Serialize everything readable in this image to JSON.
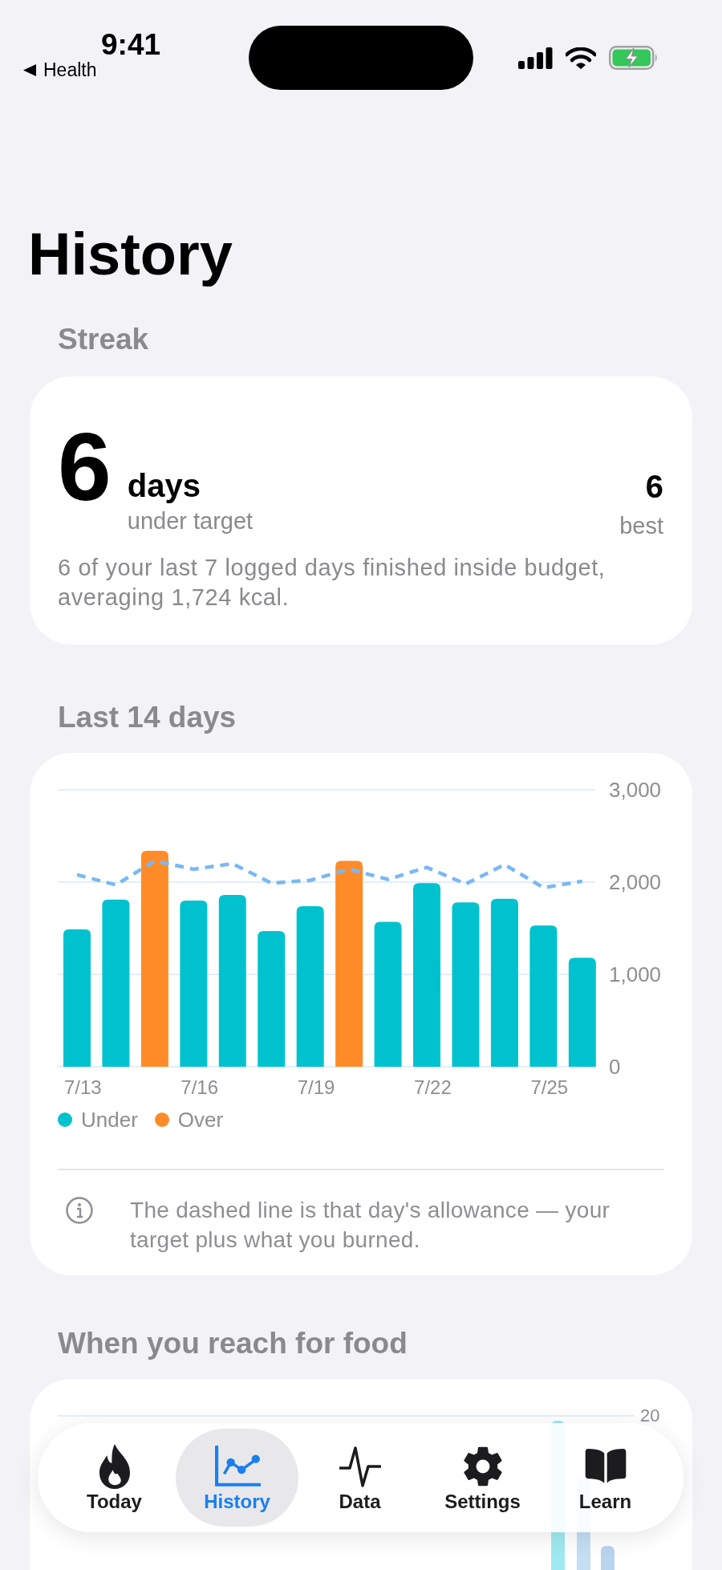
{
  "status_bar": {
    "time": "9:41",
    "back_label": "Health"
  },
  "title": "History",
  "streak": {
    "heading": "Streak",
    "count": "6",
    "unit": "days",
    "caption": "under target",
    "best_value": "6",
    "best_label": "best",
    "summary": "6 of your last 7 logged days finished inside budget, averaging 1,724 kcal."
  },
  "last_14_days": {
    "heading": "Last 14 days",
    "chart_data": {
      "type": "bar",
      "stacked": true,
      "categories": [
        "7/13",
        null,
        null,
        "7/16",
        null,
        null,
        "7/19",
        null,
        null,
        "7/22",
        null,
        null,
        "7/25",
        null
      ],
      "ylim": [
        0,
        3000
      ],
      "yticks": [
        {
          "value": 0,
          "label": "0"
        },
        {
          "value": 1000,
          "label": "1,000"
        },
        {
          "value": 2000,
          "label": "2,000"
        },
        {
          "value": 3000,
          "label": "3,000"
        }
      ],
      "series": [
        {
          "name": "Under",
          "type": "bar",
          "color": "#00c2cf",
          "values": [
            1490,
            1810,
            null,
            1800,
            1860,
            1470,
            1740,
            null,
            1570,
            1990,
            1780,
            1820,
            1530,
            1180
          ]
        },
        {
          "name": "Over",
          "type": "bar",
          "color": "#ff8c28",
          "values": [
            null,
            null,
            2340,
            null,
            null,
            null,
            null,
            2230,
            null,
            null,
            null,
            null,
            null,
            null
          ]
        },
        {
          "type": "line",
          "line_style": "dashed",
          "color": "#7ab8f4",
          "values": [
            2080,
            1970,
            2230,
            2140,
            2200,
            1990,
            2020,
            2140,
            2030,
            2160,
            1980,
            2190,
            1940,
            2010
          ]
        }
      ]
    },
    "note": "The dashed line is that day's allowance — your target plus what you burned."
  },
  "food_timing": {
    "heading": "When you reach for food",
    "tick_label": "20"
  },
  "tab_bar": {
    "items": [
      {
        "label": "Today",
        "selected": false
      },
      {
        "label": "History",
        "selected": true
      },
      {
        "label": "Data",
        "selected": false
      },
      {
        "label": "Settings",
        "selected": false
      },
      {
        "label": "Learn",
        "selected": false
      }
    ]
  }
}
